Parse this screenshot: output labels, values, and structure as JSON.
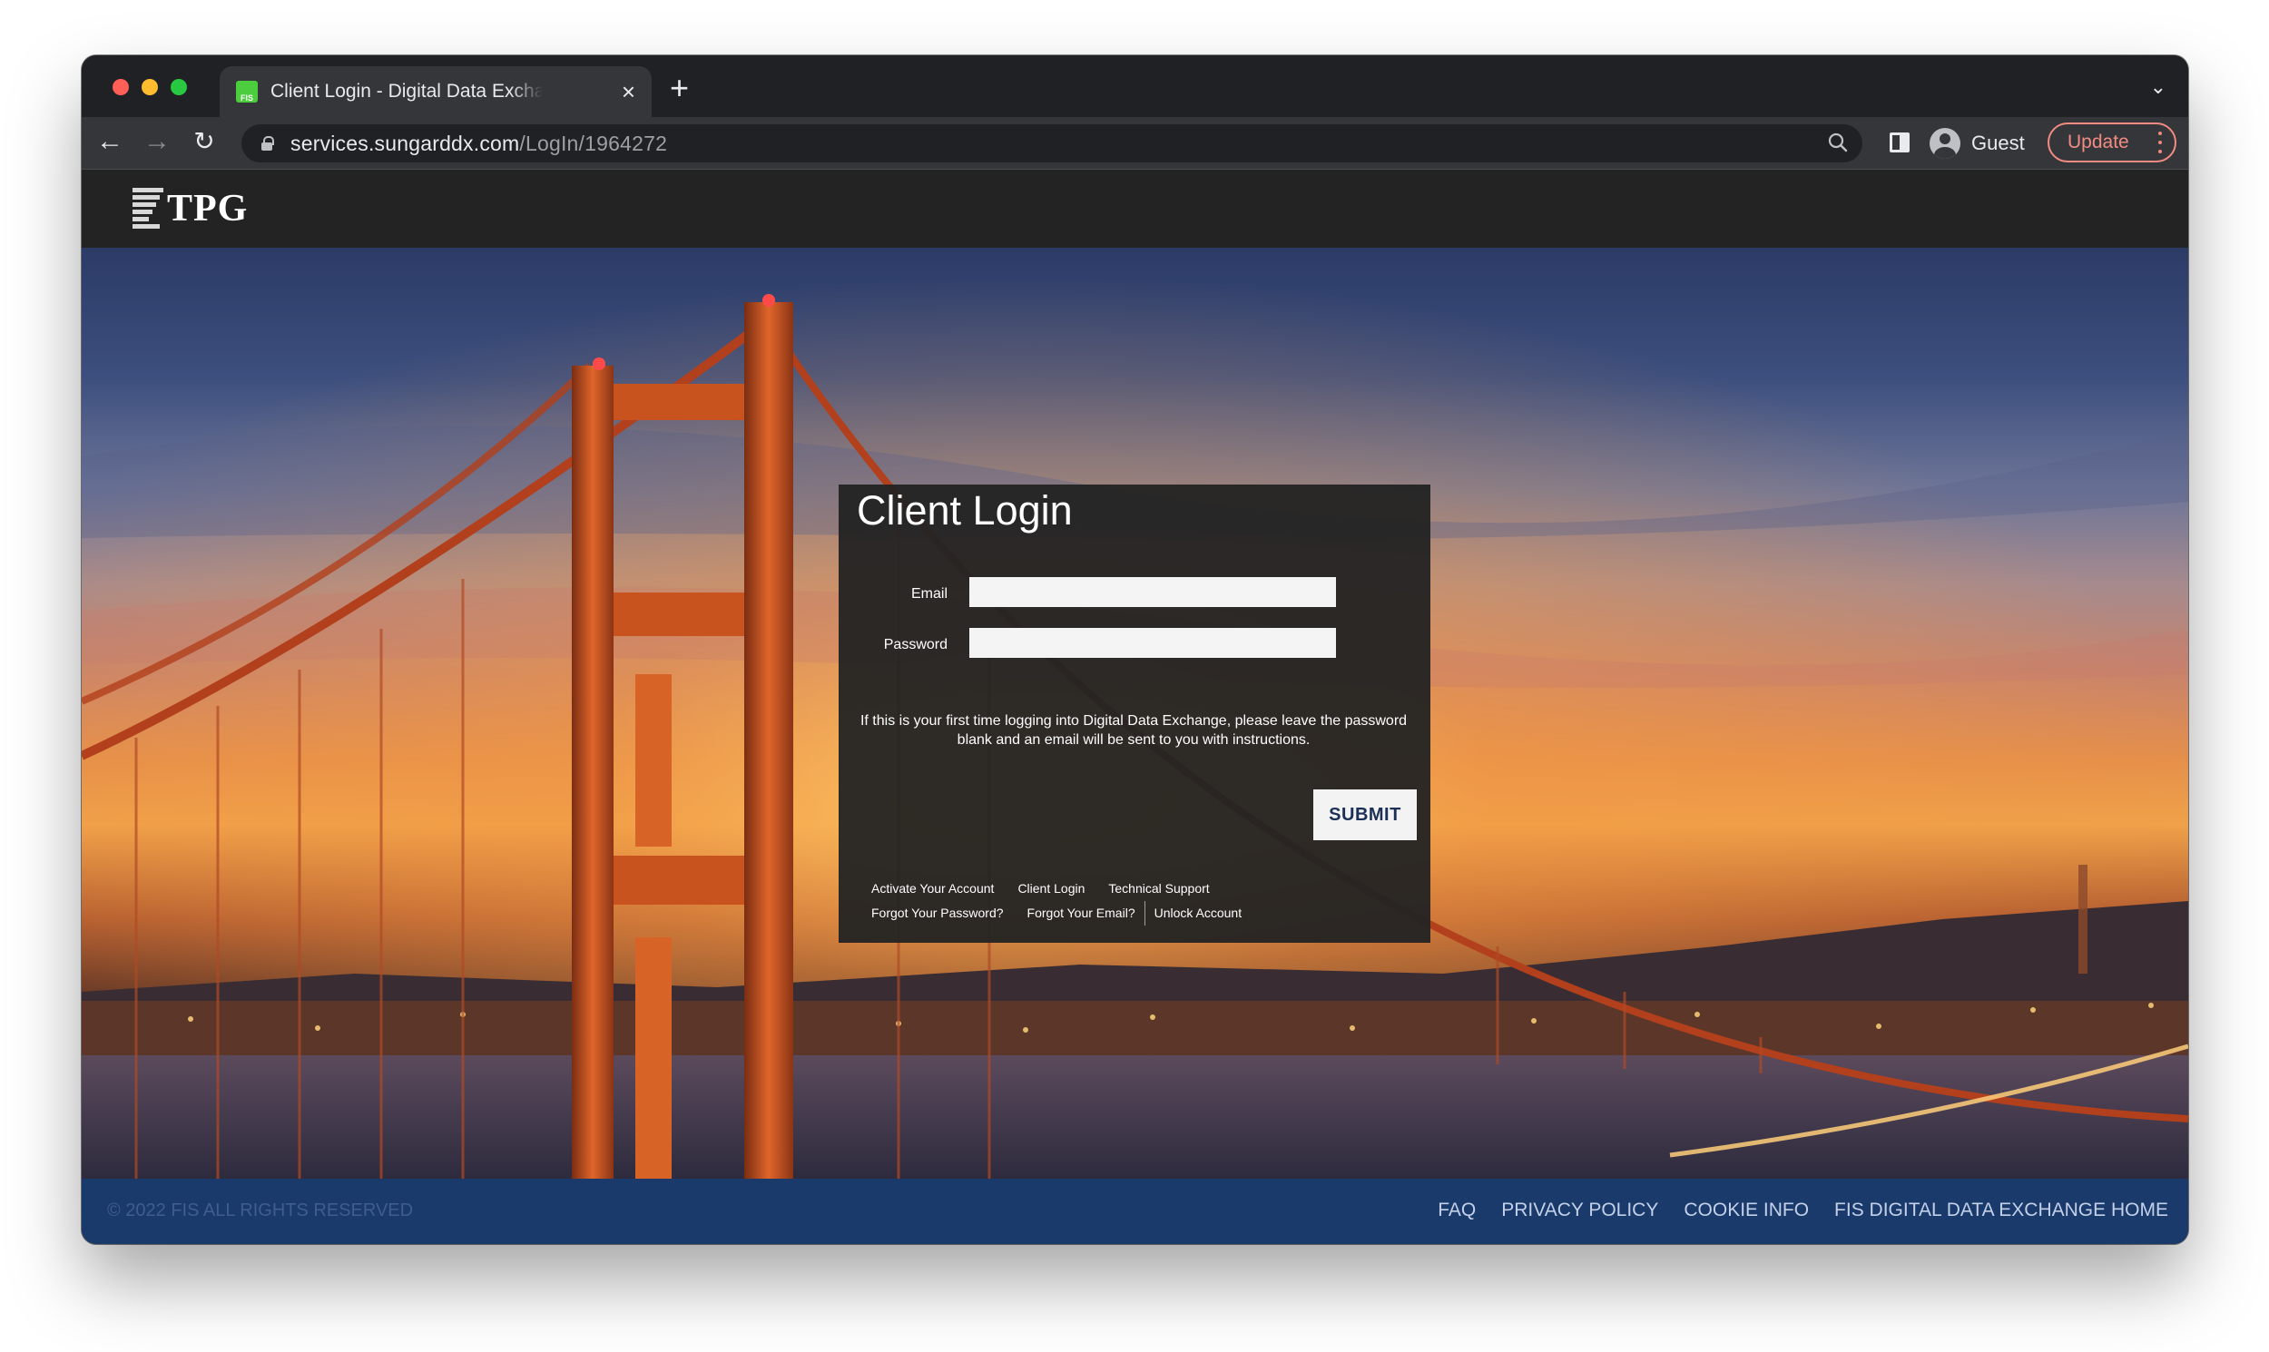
{
  "browser": {
    "tab": {
      "favicon_text": "FIS",
      "title": "Client Login - Digital Data Exchange",
      "close": "×"
    },
    "new_tab": "+",
    "url_host": "services.sungarddx.com",
    "url_path": "/LogIn/1964272",
    "profile_label": "Guest",
    "update_label": "Update"
  },
  "site": {
    "logo_text": "TPG"
  },
  "login": {
    "title": "Client Login",
    "email_label": "Email",
    "email_value": "",
    "password_label": "Password",
    "password_value": "",
    "instructions": "If this is your first time logging into Digital Data Exchange, please leave the password blank and an email will be sent to you with instructions.",
    "submit_label": "SUBMIT",
    "links_row1": [
      "Activate Your Account",
      "Client Login",
      "Technical Support"
    ],
    "links_row2": [
      "Forgot Your Password?",
      "Forgot Your Email?",
      "Unlock Account"
    ]
  },
  "footer": {
    "copyright": "© 2022 FIS ALL RIGHTS RESERVED",
    "links": [
      "FAQ",
      "PRIVACY POLICY",
      "COOKIE INFO",
      "FIS DIGITAL DATA EXCHANGE HOME"
    ]
  },
  "colors": {
    "footer_bg": "#1a3a6c",
    "header_bg": "#232323",
    "submit_text": "#1c2f57",
    "update_accent": "#f28b82"
  }
}
